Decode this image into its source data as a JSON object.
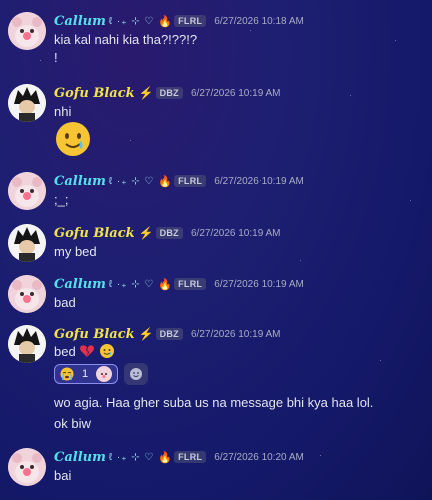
{
  "users": {
    "callum": {
      "name": "Callum",
      "decor": "ℓ ·₊ ⊹ ♡",
      "tag": "FLRL",
      "icon": "flame-icon"
    },
    "gofu": {
      "name": "Gofu Black",
      "tag": "DBZ",
      "icon": "lightning-bolt-icon"
    }
  },
  "messages": [
    {
      "author": "callum",
      "time": "6/27/2026 10:18 AM",
      "lines": [
        "kia kal nahi kia tha?!??!?",
        "!"
      ]
    },
    {
      "author": "gofu",
      "time": "6/27/2026 10:19 AM",
      "lines": [
        "nhi"
      ],
      "emoji": "smiling-face-with-tear"
    },
    {
      "author": "callum",
      "time": "6/27/2026 10:19 AM",
      "lines": [
        ";_;"
      ]
    },
    {
      "author": "gofu",
      "time": "6/27/2026 10:19 AM",
      "lines": [
        "my bed"
      ]
    },
    {
      "author": "callum",
      "time": "6/27/2026 10:19 AM",
      "lines": [
        "bad"
      ]
    },
    {
      "author": "gofu",
      "time": "6/27/2026 10:19 AM",
      "lines": [
        "bed"
      ],
      "reaction": {
        "emoji": "crying-face-emoji",
        "count": "1"
      },
      "followups": [
        "wo agia. Haa gher suba us na message bhi kya haa lol.",
        "ok biw"
      ]
    },
    {
      "author": "callum",
      "time": "6/27/2026 10:20 AM",
      "lines": [
        "bai"
      ]
    }
  ],
  "colors": {
    "callum_name": "#53e0ea",
    "gofu_name": "#f2e34a",
    "reaction_border": "#8d8ff0",
    "background": "#1a1d6e"
  }
}
